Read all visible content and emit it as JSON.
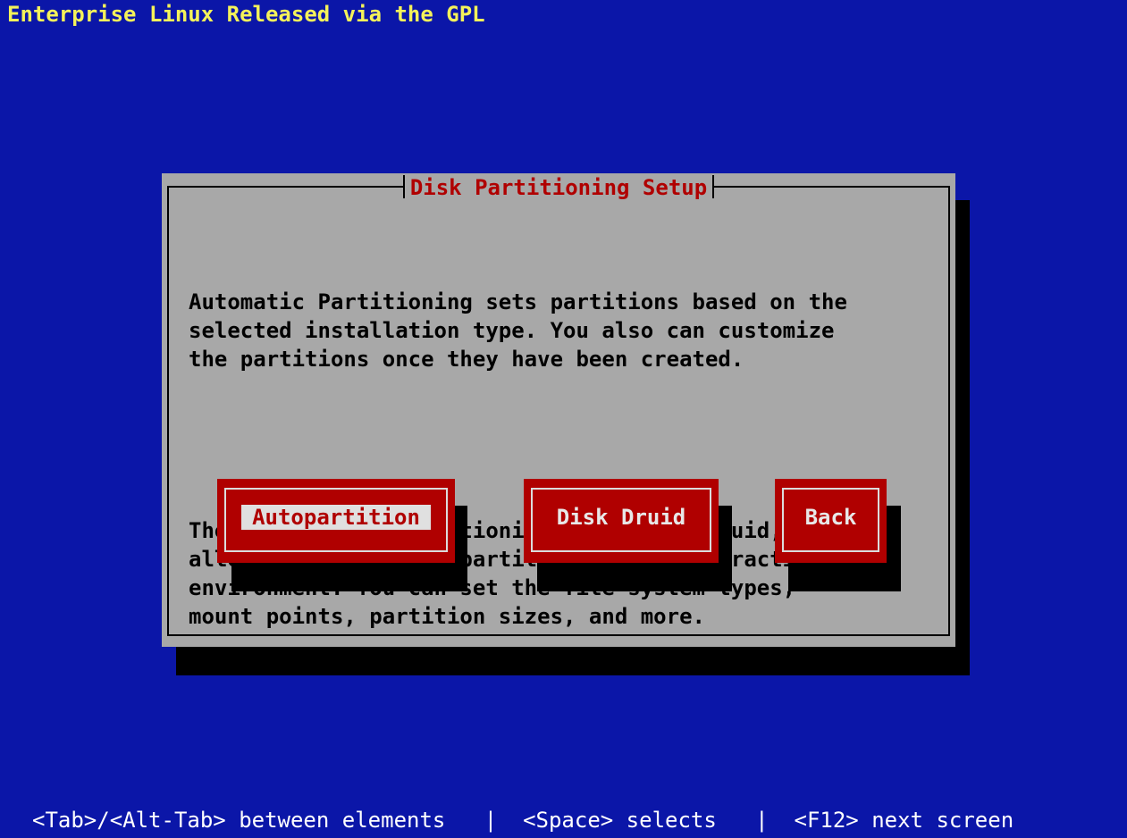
{
  "screen": {
    "top_banner": "Enterprise Linux Released via the GPL",
    "bottom_help": "<Tab>/<Alt-Tab> between elements   |  <Space> selects   |  <F12> next screen"
  },
  "dialog": {
    "title": "Disk Partitioning Setup",
    "paragraph_1": "Automatic Partitioning sets partitions based on the\nselected installation type. You also can customize\nthe partitions once they have been created.",
    "paragraph_2": "The manual disk partitioning tool, Disk Druid,\nallows you to create partitions in an interactive\nenvironment. You can set the file system types,\nmount points, partition sizes, and more.",
    "buttons": [
      {
        "label": "Autopartition",
        "focused": true
      },
      {
        "label": "Disk Druid",
        "focused": false
      },
      {
        "label": "Back",
        "focused": false
      }
    ]
  },
  "colors": {
    "background": "#0b16a8",
    "dialog": "#a8a8a8",
    "title_text": "#b00000",
    "button": "#b00000",
    "banner_text": "#f4f25a"
  }
}
